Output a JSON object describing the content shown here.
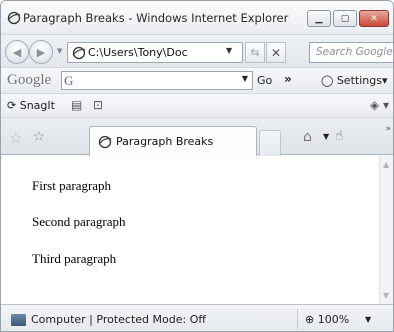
{
  "window": {
    "title": "Paragraph Breaks - Windows Internet Explorer"
  },
  "navigation": {
    "address": "C:\\Users\\Tony\\Doc",
    "search_placeholder": "Search Google"
  },
  "google_toolbar": {
    "logo": "Google",
    "search_glyph": "G",
    "go_label": "Go",
    "settings_label": "Settings"
  },
  "snagit_toolbar": {
    "label": "SnagIt"
  },
  "tab": {
    "title": "Paragraph Breaks"
  },
  "content": {
    "paragraphs": [
      "First paragraph",
      "Second paragraph",
      "Third paragraph"
    ]
  },
  "status": {
    "zone": "Computer | Protected Mode: Off",
    "zoom": "100%"
  },
  "icons": {
    "ie": "ie-icon",
    "back": "back-arrow-icon",
    "forward": "forward-arrow-icon",
    "refresh": "refresh-icon",
    "stop": "stop-icon",
    "favorites": "favorites-star-icon",
    "home": "home-icon",
    "computer": "computer-icon"
  },
  "colors": {
    "chrome_bg": "#e9ecf0",
    "close_button": "#c9483a",
    "page_bg": "#ffffff"
  }
}
